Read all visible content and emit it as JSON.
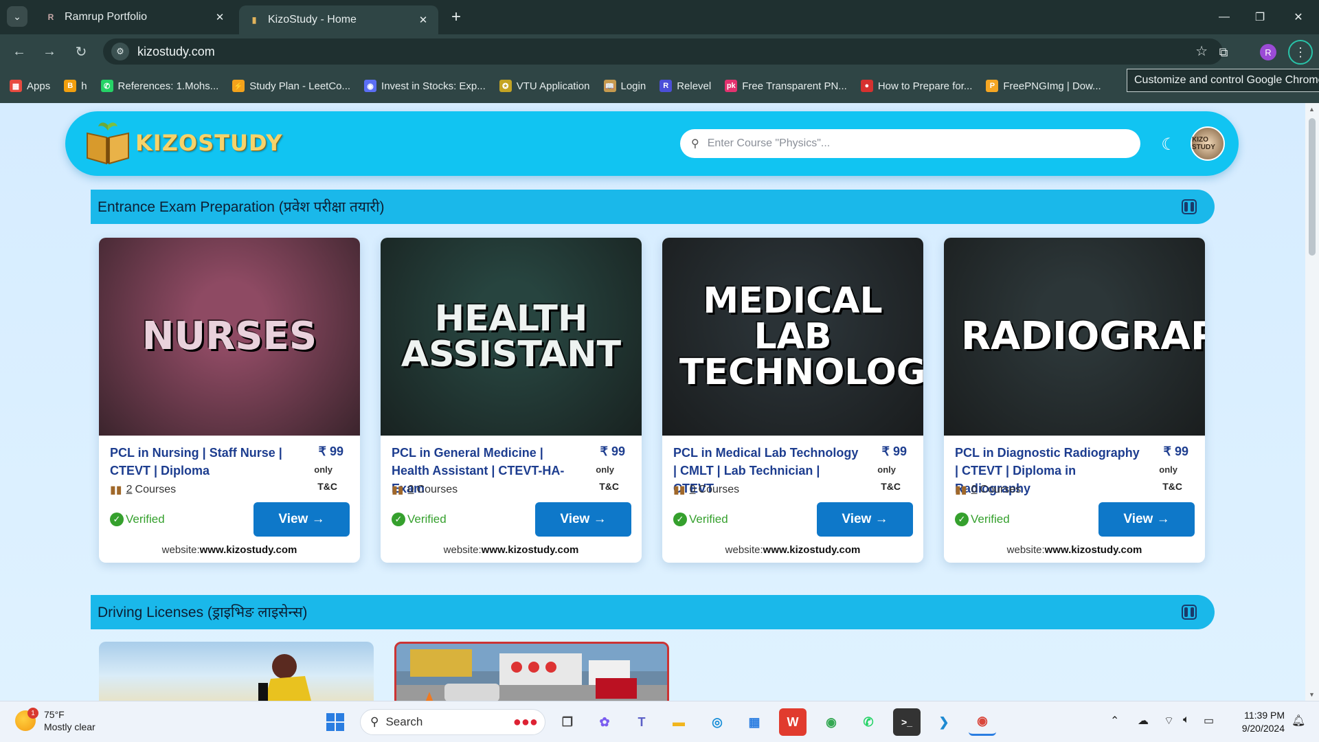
{
  "browser": {
    "tabs": [
      {
        "title": "Ramrup Portfolio",
        "active": false
      },
      {
        "title": "KizoStudy - Home",
        "active": true
      }
    ],
    "url": "kizostudy.com",
    "profile_initial": "R",
    "tooltip": "Customize and control Google Chrome",
    "bookmarks": [
      {
        "label": "Apps",
        "color": "#e84a3f",
        "glyph": "▦"
      },
      {
        "label": "h",
        "color": "#f29f0e",
        "glyph": "B"
      },
      {
        "label": "References: 1.Mohs...",
        "color": "#25d366",
        "glyph": "✆"
      },
      {
        "label": "Study Plan - LeetCo...",
        "color": "#f3a21b",
        "glyph": "⚡"
      },
      {
        "label": "Invest in Stocks: Exp...",
        "color": "#5b6ef5",
        "glyph": "◉"
      },
      {
        "label": "VTU Application",
        "color": "#c4a423",
        "glyph": "✪"
      },
      {
        "label": "Login",
        "color": "#c69a4e",
        "glyph": "📖"
      },
      {
        "label": "Relevel",
        "color": "#4b4fd8",
        "glyph": "R"
      },
      {
        "label": "Free Transparent PN...",
        "color": "#e4326f",
        "glyph": "pk"
      },
      {
        "label": "How to Prepare for...",
        "color": "#d6312f",
        "glyph": "●"
      },
      {
        "label": "FreePNGImg | Dow...",
        "color": "#f5a623",
        "glyph": "P"
      }
    ]
  },
  "site": {
    "logo_text": "KIZOSTUDY",
    "search_placeholder": "Enter Course \"Physics\"...",
    "avatar_text": "KIZO STUDY"
  },
  "sections": [
    {
      "title": "Entrance Exam Preparation (प्रवेश परीक्षा तयारी)",
      "cards": [
        {
          "thumb_text": "NURSES",
          "thumb_bg": "#8e4a63",
          "thumb_fg": "#e9d2dc",
          "title": "PCL in Nursing | Staff Nurse | CTEVT | Diploma",
          "price": "₹ 99",
          "price_note": "only",
          "terms": "T&C",
          "course_count": "2",
          "courses_label": "Courses",
          "verified": "Verified",
          "button": "View →",
          "website_label": "website:",
          "website": "www.kizostudy.com"
        },
        {
          "thumb_text": "HEALTH ASSISTANT",
          "thumb_bg": "#27443f",
          "thumb_fg": "#eef3f1",
          "title": "PCL in General Medicine | Health Assistant | CTEVT-HA-Exam",
          "price": "₹ 99",
          "price_note": "only",
          "terms": "T&C",
          "course_count": "0",
          "courses_label": "Courses",
          "verified": "Verified",
          "button": "View →",
          "website_label": "website:",
          "website": "www.kizostudy.com"
        },
        {
          "thumb_text": "MEDICAL LAB TECHNOLOGY",
          "thumb_bg": "#2a3236",
          "thumb_fg": "#ffffff",
          "title": "PCL in Medical Lab Technology | CMLT | Lab Technician | CTEVT",
          "price": "₹ 99",
          "price_note": "only",
          "terms": "T&C",
          "course_count": "0",
          "courses_label": "Courses",
          "verified": "Verified",
          "button": "View →",
          "website_label": "website:",
          "website": "www.kizostudy.com"
        },
        {
          "thumb_text": "RADIOGRAPHY",
          "thumb_bg": "#2c3638",
          "thumb_fg": "#ffffff",
          "title": "PCL in Diagnostic Radiography | CTEVT | Diploma in Radiography",
          "price": "₹ 99",
          "price_note": "only",
          "terms": "T&C",
          "course_count": "0",
          "courses_label": "Courses",
          "verified": "Verified",
          "button": "View →",
          "website_label": "website:",
          "website": "www.kizostudy.com"
        }
      ]
    },
    {
      "title": "Driving Licenses (ड्राइभिङ लाइसेन्स)",
      "cards": []
    }
  ],
  "taskbar": {
    "temp": "75°F",
    "weather": "Mostly clear",
    "weather_badge": "1",
    "search_label": "Search",
    "time": "11:39 PM",
    "date": "9/20/2024"
  },
  "colors": {
    "header_cyan": "#11c4f2",
    "section_bar": "#1ab8ea",
    "view_button": "#0e78c9",
    "title_blue": "#1d3d8f",
    "verified_green": "#35a02d"
  }
}
